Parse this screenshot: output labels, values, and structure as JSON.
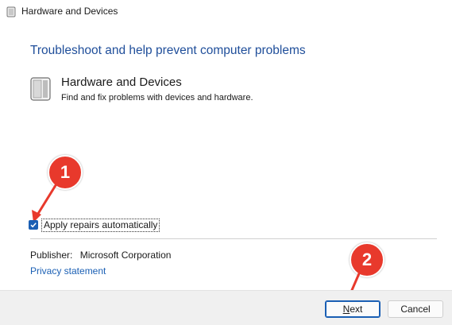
{
  "window": {
    "title": "Hardware and Devices"
  },
  "heading": "Troubleshoot and help prevent computer problems",
  "item": {
    "title": "Hardware and Devices",
    "description": "Find and fix problems with devices and hardware.",
    "icon": "hardware-device-icon"
  },
  "annotations": [
    {
      "label": "1",
      "color": "#e8392c"
    },
    {
      "label": "2",
      "color": "#e8392c"
    }
  ],
  "checkbox": {
    "label": "Apply repairs automatically",
    "checked": true
  },
  "publisher": {
    "label": "Publisher:",
    "value": "Microsoft Corporation"
  },
  "privacy_link": "Privacy statement",
  "buttons": {
    "next_mnemonic": "N",
    "next_rest": "ext",
    "cancel": "Cancel"
  },
  "colors": {
    "accent": "#1a5fb4",
    "heading": "#1f4e9a",
    "annotation": "#e8392c"
  }
}
